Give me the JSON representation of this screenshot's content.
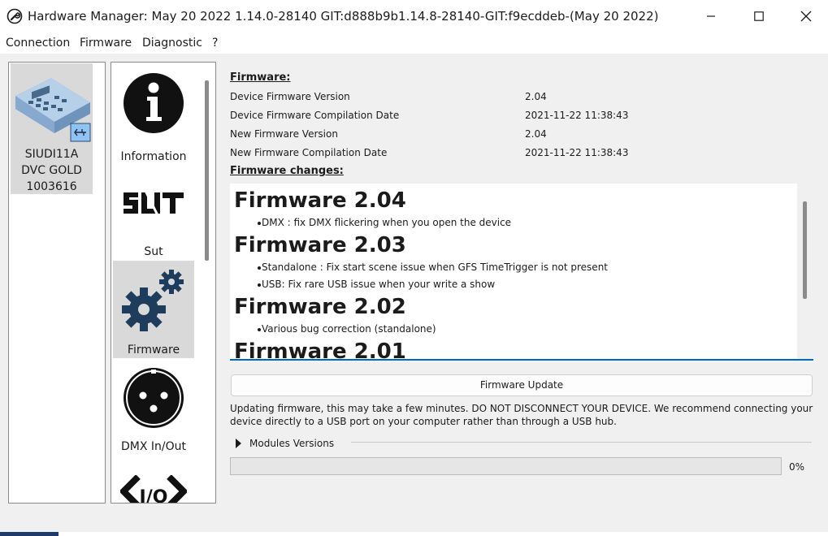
{
  "window": {
    "title": "Hardware Manager: May 20 2022 1.14.0-28140 GIT:d888b9b1.14.8-28140-GIT:f9ecddeb-(May 20 2022)",
    "minimize_icon": "minimize-icon",
    "maximize_icon": "maximize-icon",
    "close_icon": "close-icon"
  },
  "menu": {
    "items": [
      "Connection",
      "Firmware",
      "Diagnostic",
      "?"
    ]
  },
  "device": {
    "line1": "SIUDI11A",
    "line2": "DVC GOLD",
    "line3": "1003616",
    "icon": "usb-device-icon"
  },
  "sections": {
    "items": [
      {
        "label": "Information",
        "icon": "information-icon"
      },
      {
        "label": "Sut",
        "icon": "sut-logo-icon"
      },
      {
        "label": "Firmware",
        "icon": "gears-icon",
        "selected": true
      },
      {
        "label": "DMX In/Out",
        "icon": "xlr-connector-icon"
      },
      {
        "label": "",
        "icon": "io-icon"
      }
    ]
  },
  "firmware": {
    "heading": "Firmware:",
    "device_version_label": "Device Firmware Version",
    "device_version_value": "2.04",
    "device_date_label": "Device Firmware Compilation Date",
    "device_date_value": "2021-11-22 11:38:43",
    "new_version_label": "New Firmware Version",
    "new_version_value": "2.04",
    "new_date_label": "New Firmware Compilation Date",
    "new_date_value": "2021-11-22 11:38:43",
    "changes_heading": "Firmware changes:",
    "changes": [
      {
        "title": "Firmware 2.04",
        "items": [
          "DMX : fix DMX flickering when you open the device"
        ]
      },
      {
        "title": "Firmware 2.03",
        "items": [
          "Standalone : Fix start scene issue when GFS TimeTrigger is not present",
          "USB: Fix rare USB issue when your write a show"
        ]
      },
      {
        "title": "Firmware 2.02",
        "items": [
          "Various bug correction (standalone)"
        ]
      },
      {
        "title": "Firmware 2.01",
        "items": []
      }
    ],
    "update_button": "Firmware Update",
    "warning": "Updating firmware, this may take a few minutes. DO NOT DISCONNECT YOUR DEVICE. We recommend connecting your device directly to a USB port on your computer rather than through a USB hub.",
    "modules_label": "Modules Versions",
    "progress_value": 0,
    "progress_text": "0%"
  },
  "colors": {
    "accent": "#0067c0",
    "selected_bg": "#d9d9d9",
    "window_bg": "#f0f0f0"
  }
}
